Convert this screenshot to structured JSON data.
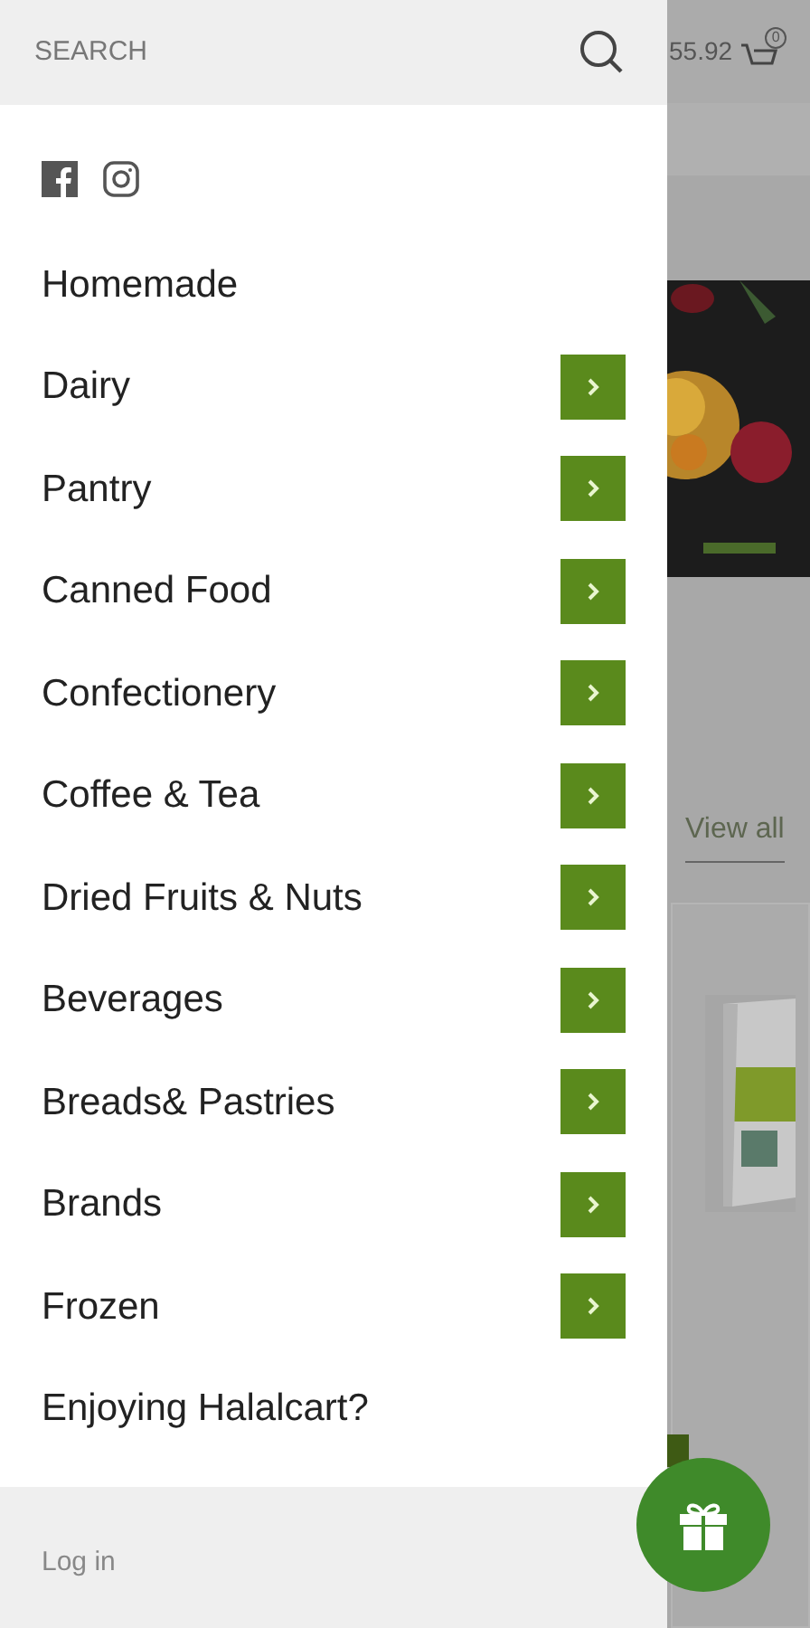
{
  "drawer": {
    "search": {
      "placeholder": "SEARCH"
    },
    "menu": [
      {
        "label": "Homemade",
        "has_submenu": false
      },
      {
        "label": "Dairy",
        "has_submenu": true
      },
      {
        "label": "Pantry",
        "has_submenu": true
      },
      {
        "label": "Canned Food",
        "has_submenu": true
      },
      {
        "label": "Confectionery",
        "has_submenu": true
      },
      {
        "label": "Coffee & Tea",
        "has_submenu": true
      },
      {
        "label": "Dried Fruits & Nuts",
        "has_submenu": true
      },
      {
        "label": "Beverages",
        "has_submenu": true
      },
      {
        "label": "Breads& Pastries",
        "has_submenu": true
      },
      {
        "label": "Brands",
        "has_submenu": true
      },
      {
        "label": "Frozen",
        "has_submenu": true
      },
      {
        "label": "Enjoying Halalcart?",
        "has_submenu": false
      }
    ],
    "footer_links": [
      "Log in"
    ]
  },
  "page": {
    "cart_total": "55.92",
    "cart_count": "0",
    "view_all": "View all"
  }
}
